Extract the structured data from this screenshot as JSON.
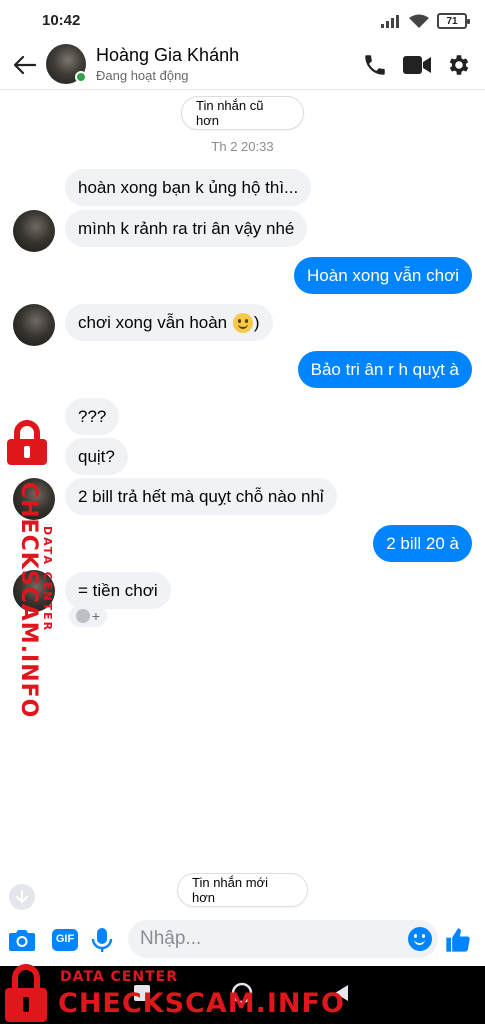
{
  "status_bar": {
    "time": "10:42",
    "battery": "71"
  },
  "header": {
    "contact_name": "Hoàng Gia Khánh",
    "contact_status": "Đang hoạt động"
  },
  "conversation": {
    "older_button_label": "Tin nhắn cũ hơn",
    "timestamp": "Th 2 20:33",
    "messages": [
      {
        "from": "them",
        "text": "hoàn xong bạn k ủng hộ thì..."
      },
      {
        "from": "them",
        "text": "mình k rảnh ra tri ân vậy nhé"
      },
      {
        "from": "me",
        "text": "Hoàn xong vẫn chơi"
      },
      {
        "from": "them",
        "text": "chơi xong vẫn hoàn",
        "suffix": ")",
        "emoji": "slightly-smiling-face"
      },
      {
        "from": "me",
        "text": "Bảo tri ân r h quỵt à"
      },
      {
        "from": "them",
        "text": "???"
      },
      {
        "from": "them",
        "text": "quịt?"
      },
      {
        "from": "them",
        "text": "2 bill trả hết mà quỵt chỗ nào nhỉ"
      },
      {
        "from": "me",
        "text": "2 bill 20 à"
      },
      {
        "from": "them",
        "text": "= tiền chơi"
      }
    ],
    "reaction_add": "+",
    "newer_button_label": "Tin nhắn mới hơn"
  },
  "composer": {
    "placeholder": "Nhập...",
    "icons": [
      "camera-icon",
      "gif-icon",
      "microphone-icon",
      "emoji-icon",
      "like-icon"
    ],
    "gif_label": "GIF"
  },
  "watermark": {
    "small_text": "DATA CENTER",
    "big_text": "CHECKSCAM.INFO"
  },
  "colors": {
    "accent": "#0084ff",
    "incoming_bubble": "#f0f2f5",
    "online": "#31a24c",
    "watermark": "#e0161d"
  }
}
